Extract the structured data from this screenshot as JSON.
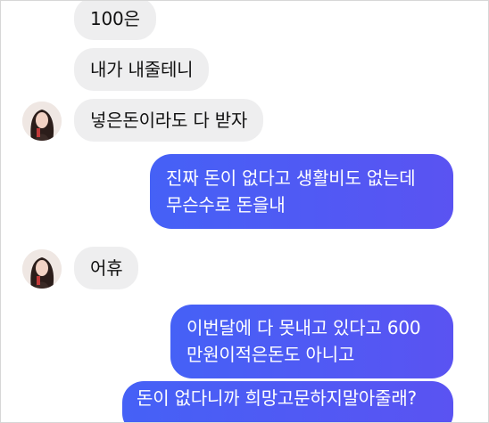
{
  "chat": {
    "messages": [
      {
        "id": "m1",
        "sender": "other",
        "text": "100은"
      },
      {
        "id": "m2",
        "sender": "other",
        "text": "내가 내줄테니"
      },
      {
        "id": "m3",
        "sender": "other",
        "text": "넣은돈이라도 다 받자"
      },
      {
        "id": "m4",
        "sender": "me",
        "lines": [
          "진짜 돈이 없다고 생활비도 없는데",
          "무슨수로 돈을내"
        ]
      },
      {
        "id": "m5",
        "sender": "other",
        "text": "어휴"
      },
      {
        "id": "m6",
        "sender": "me",
        "lines": [
          "이번달에 다 못내고 있다고 600",
          "만원이적은돈도 아니고"
        ]
      },
      {
        "id": "m7",
        "sender": "me",
        "text": "돈이 없다니까 희망고문하지말아줄래?"
      }
    ]
  },
  "colors": {
    "incoming_bubble": "#eeeeef",
    "outgoing_bubble": "#4b5cf5",
    "outgoing_text": "#ffffff"
  },
  "icons": {
    "avatar": "contact-avatar-photo"
  }
}
